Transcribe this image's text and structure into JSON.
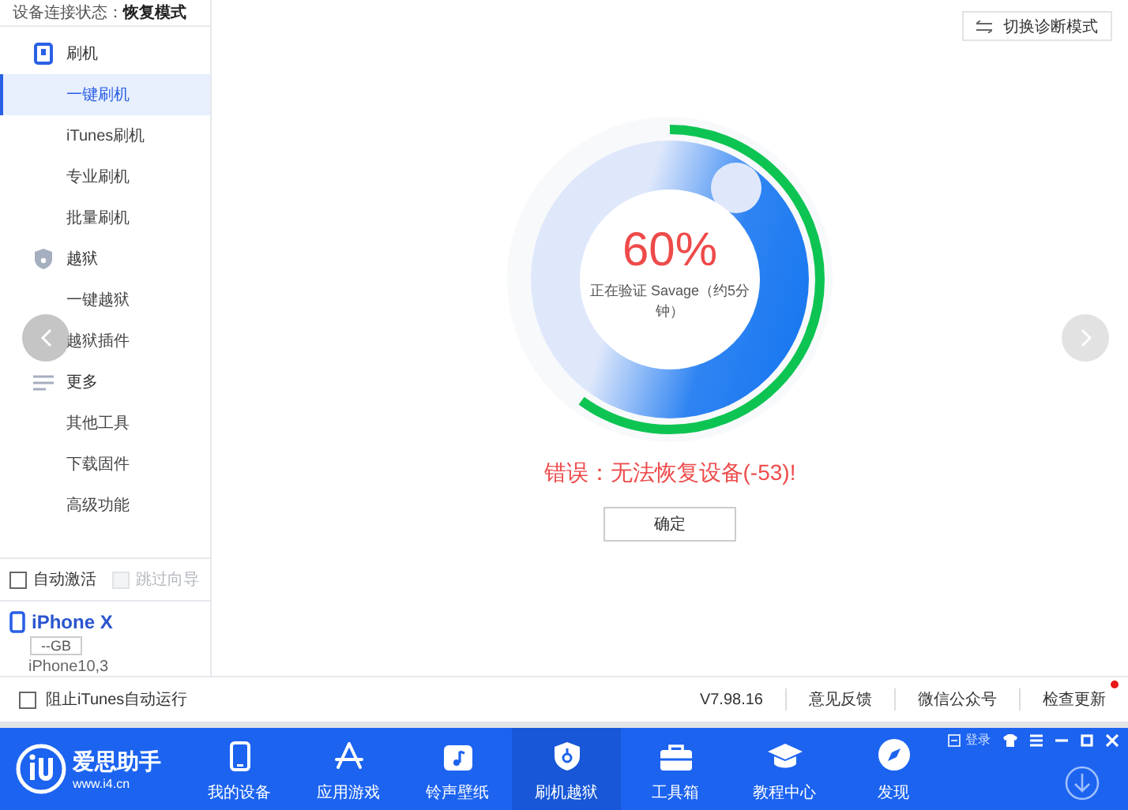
{
  "sidebar": {
    "status_label": "设备连接状态：",
    "status_value": "恢复模式",
    "groups": [
      {
        "label": "刷机",
        "kind": "phone",
        "items": [
          {
            "label": "一键刷机",
            "selected": true
          },
          {
            "label": "iTunes刷机",
            "selected": false
          },
          {
            "label": "专业刷机",
            "selected": false
          },
          {
            "label": "批量刷机",
            "selected": false
          }
        ]
      },
      {
        "label": "越狱",
        "kind": "shield",
        "items": [
          {
            "label": "一键越狱",
            "selected": false
          },
          {
            "label": "越狱插件",
            "selected": false
          }
        ]
      },
      {
        "label": "更多",
        "kind": "lines",
        "items": [
          {
            "label": "其他工具",
            "selected": false
          },
          {
            "label": "下载固件",
            "selected": false
          },
          {
            "label": "高级功能",
            "selected": false
          }
        ]
      }
    ],
    "options": [
      {
        "label": "自动激活",
        "checked": false,
        "disabled": false
      },
      {
        "label": "跳过向导",
        "checked": false,
        "disabled": true
      }
    ],
    "device": {
      "name": "iPhone X",
      "storage": "--GB",
      "model": "iPhone10,3"
    }
  },
  "main": {
    "mode_button": "切换诊断模式",
    "progress": {
      "level": 0.6,
      "percent": "60%",
      "status": "正在验证 Savage（约5分钟）"
    },
    "error": "错误：无法恢复设备(-53)!",
    "confirm_button": "确定"
  },
  "status_bar": {
    "checkbox": {
      "label": "阻止iTunes自动运行",
      "checked": false
    },
    "version": "V7.98.16",
    "links": [
      {
        "label": "意见反馈",
        "badge": false
      },
      {
        "label": "微信公众号",
        "badge": false
      },
      {
        "label": "检查更新",
        "badge": true
      }
    ]
  },
  "nav": {
    "logo_name": "爱思助手",
    "logo_url": "www.i4.cn",
    "login": "登录",
    "items": [
      {
        "label": "我的设备",
        "kind": "phone",
        "selected": false
      },
      {
        "label": "应用游戏",
        "kind": "apps",
        "selected": false
      },
      {
        "label": "铃声壁纸",
        "kind": "music",
        "selected": false
      },
      {
        "label": "刷机越狱",
        "kind": "shield",
        "selected": true
      },
      {
        "label": "工具箱",
        "kind": "toolbox",
        "selected": false
      },
      {
        "label": "教程中心",
        "kind": "cap",
        "selected": false
      },
      {
        "label": "发现",
        "kind": "compass",
        "selected": false
      }
    ]
  }
}
